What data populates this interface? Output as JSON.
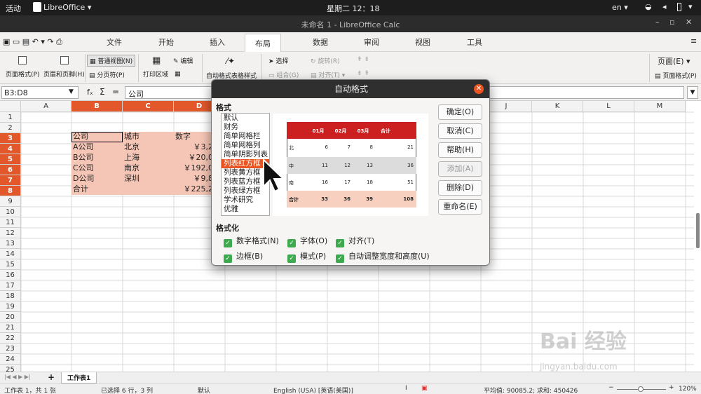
{
  "topbar": {
    "activities": "活动",
    "app_menu": "LibreOffice ▾",
    "clock": "星期二 12：18",
    "lang": "en ▾"
  },
  "window": {
    "title": "未命名 1 - LibreOffice Calc"
  },
  "notebook_tabs": [
    "文件",
    "开始",
    "插入",
    "布局",
    "数据",
    "审阅",
    "视图",
    "工具"
  ],
  "ribbon": {
    "page_format": "页面格式(P)",
    "header_footer": "页眉和页脚(H)",
    "normal_view": "普通视图(N)",
    "page_break": "分页符(P)",
    "print_range": "打印区域",
    "edit": "编辑",
    "autoformat": "自动格式表格样式",
    "select": "选择",
    "group": "组合(G)",
    "rotate": "旋转(R)",
    "align": "对齐(T)",
    "page_menu": "页面(E) ▾",
    "page_format2": "页面格式(P)"
  },
  "formula": {
    "name_box": "B3:D8",
    "fx": "fₓ",
    "sigma": "Σ",
    "equals": "=",
    "content": "公司"
  },
  "columns": [
    "A",
    "B",
    "C",
    "D",
    "E",
    "F",
    "G",
    "H",
    "I",
    "J",
    "K",
    "L",
    "M"
  ],
  "rows": [
    "1",
    "2",
    "3",
    "4",
    "5",
    "6",
    "7",
    "8",
    "9",
    "10",
    "11",
    "12",
    "13",
    "14",
    "15",
    "16",
    "17",
    "18",
    "19",
    "20",
    "21",
    "22",
    "23",
    "24",
    "25"
  ],
  "cells": {
    "header": [
      "公司",
      "城市",
      "数字"
    ],
    "r4": [
      "A公司",
      "北京",
      "￥3,202"
    ],
    "r5": [
      "B公司",
      "上海",
      "￥20,020"
    ],
    "r6": [
      "C公司",
      "南京",
      "￥192,099"
    ],
    "r7": [
      "D公司",
      "深圳",
      "￥9,892"
    ],
    "r8": [
      "合计",
      "",
      "￥225,213"
    ]
  },
  "dialog": {
    "title": "自动格式",
    "format_label": "格式",
    "formats": [
      "默认",
      "财务",
      "简单网格栏",
      "简单网格列",
      "简单阴影列表",
      "列表红方框",
      "列表黄方框",
      "列表蓝方框",
      "列表绿方框",
      "学术研究",
      "优雅"
    ],
    "selected_index": 5,
    "buttons": {
      "ok": "确定(O)",
      "cancel": "取消(C)",
      "help": "帮助(H)",
      "add": "添加(A)",
      "delete": "删除(D)",
      "rename": "重命名(E)"
    },
    "formatting_label": "格式化",
    "checks": {
      "number": "数字格式(N)",
      "font": "字体(O)",
      "align": "对齐(T)",
      "border": "边框(B)",
      "pattern": "模式(P)",
      "autofit": "自动调整宽度和高度(U)"
    },
    "preview": {
      "header": [
        "",
        "01月",
        "02月",
        "03月",
        "合计"
      ],
      "rows": [
        [
          "北",
          "6",
          "7",
          "8",
          "21"
        ],
        [
          "中",
          "11",
          "12",
          "13",
          "36"
        ],
        [
          "南",
          "16",
          "17",
          "18",
          "51"
        ],
        [
          "合计",
          "33",
          "36",
          "39",
          "108"
        ]
      ],
      "accent": "#cc1f1f"
    }
  },
  "sheet": {
    "tab": "工作表1"
  },
  "status": {
    "sheet_pos": "工作表 1，共 1 张",
    "selection": "已选择 6 行，3 列",
    "style": "默认",
    "lang": "English (USA) [英语(美国)]",
    "stats": "平均值: 90085.2; 求和: 450426",
    "zoom": "120%"
  },
  "watermark": {
    "brand": "Bai 经验",
    "url": "jingyan.baidu.com"
  },
  "colors": {
    "accent": "#e95420",
    "selection": "#f5c6b6"
  }
}
